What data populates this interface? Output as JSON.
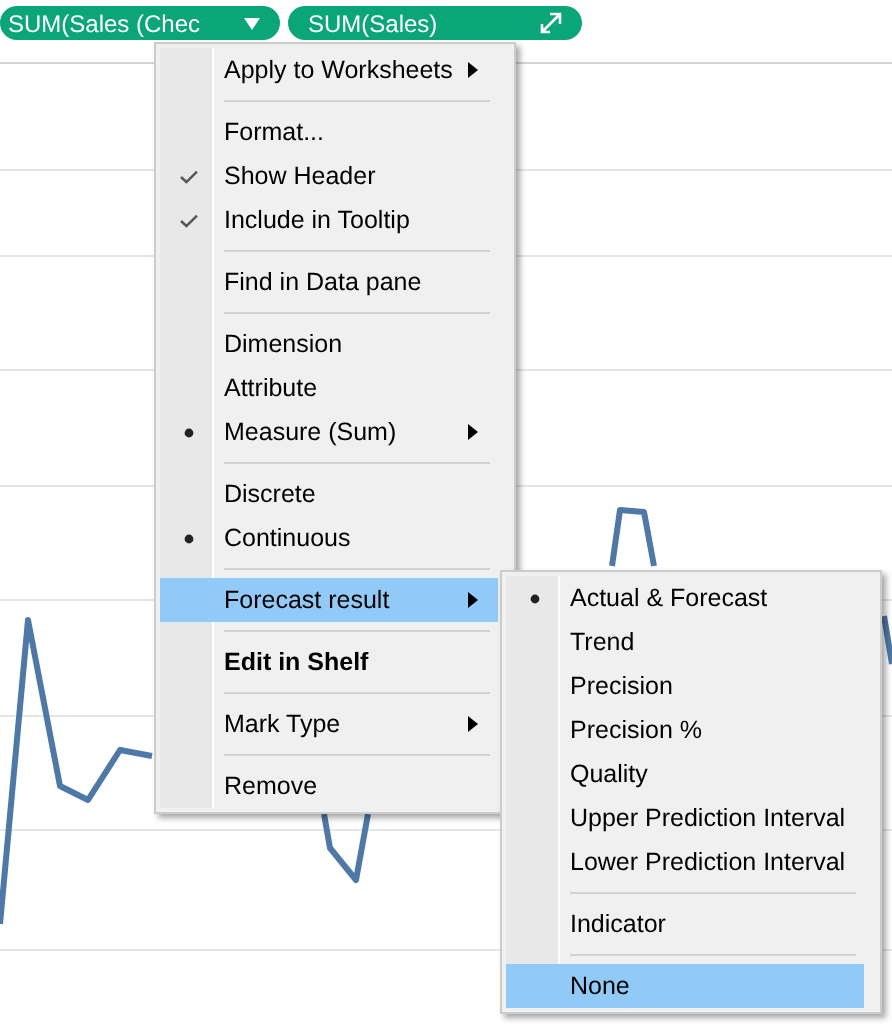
{
  "shelf": {
    "pills": [
      {
        "label": "SUM(Sales (Chec"
      },
      {
        "label": "SUM(Sales)"
      }
    ]
  },
  "main_menu": {
    "items": [
      {
        "kind": "item",
        "label": "Apply to Worksheets",
        "submenu": true,
        "selected": false,
        "bold": false
      },
      {
        "kind": "separator"
      },
      {
        "kind": "item",
        "label": "Format...",
        "submenu": false,
        "selected": false,
        "bold": false
      },
      {
        "kind": "check_item",
        "label": "Show Header",
        "checked": true,
        "submenu": false,
        "selected": false,
        "bold": false
      },
      {
        "kind": "check_item",
        "label": "Include in Tooltip",
        "checked": true,
        "submenu": false,
        "selected": false,
        "bold": false
      },
      {
        "kind": "separator"
      },
      {
        "kind": "item",
        "label": "Find in Data pane",
        "submenu": false,
        "selected": false,
        "bold": false
      },
      {
        "kind": "separator"
      },
      {
        "kind": "radio_item",
        "label": "Dimension",
        "checked": false,
        "submenu": false,
        "selected": false,
        "bold": false
      },
      {
        "kind": "radio_item",
        "label": "Attribute",
        "checked": false,
        "submenu": false,
        "selected": false,
        "bold": false
      },
      {
        "kind": "radio_item",
        "label": "Measure (Sum)",
        "checked": true,
        "submenu": true,
        "selected": false,
        "bold": false
      },
      {
        "kind": "separator"
      },
      {
        "kind": "radio_item",
        "label": "Discrete",
        "checked": false,
        "submenu": false,
        "selected": false,
        "bold": false
      },
      {
        "kind": "radio_item",
        "label": "Continuous",
        "checked": true,
        "submenu": false,
        "selected": false,
        "bold": false
      },
      {
        "kind": "separator"
      },
      {
        "kind": "item",
        "label": "Forecast result",
        "submenu": true,
        "selected": true,
        "bold": false
      },
      {
        "kind": "separator"
      },
      {
        "kind": "item",
        "label": "Edit in Shelf",
        "submenu": false,
        "selected": false,
        "bold": true
      },
      {
        "kind": "separator"
      },
      {
        "kind": "item",
        "label": "Mark Type",
        "submenu": true,
        "selected": false,
        "bold": false
      },
      {
        "kind": "separator"
      },
      {
        "kind": "item",
        "label": "Remove",
        "submenu": false,
        "selected": false,
        "bold": false
      }
    ]
  },
  "submenu": {
    "items": [
      {
        "kind": "radio_item",
        "label": "Actual & Forecast",
        "checked": true,
        "submenu": false,
        "selected": false,
        "bold": false
      },
      {
        "kind": "radio_item",
        "label": "Trend",
        "checked": false,
        "submenu": false,
        "selected": false,
        "bold": false
      },
      {
        "kind": "radio_item",
        "label": "Precision",
        "checked": false,
        "submenu": false,
        "selected": false,
        "bold": false
      },
      {
        "kind": "radio_item",
        "label": "Precision %",
        "checked": false,
        "submenu": false,
        "selected": false,
        "bold": false
      },
      {
        "kind": "radio_item",
        "label": "Quality",
        "checked": false,
        "submenu": false,
        "selected": false,
        "bold": false
      },
      {
        "kind": "radio_item",
        "label": "Upper Prediction Interval",
        "checked": false,
        "submenu": false,
        "selected": false,
        "bold": false
      },
      {
        "kind": "radio_item",
        "label": "Lower Prediction Interval",
        "checked": false,
        "submenu": false,
        "selected": false,
        "bold": false
      },
      {
        "kind": "separator"
      },
      {
        "kind": "item",
        "label": "Indicator",
        "submenu": false,
        "selected": false,
        "bold": false
      },
      {
        "kind": "separator"
      },
      {
        "kind": "item",
        "label": "None",
        "submenu": false,
        "selected": true,
        "bold": false
      }
    ]
  }
}
